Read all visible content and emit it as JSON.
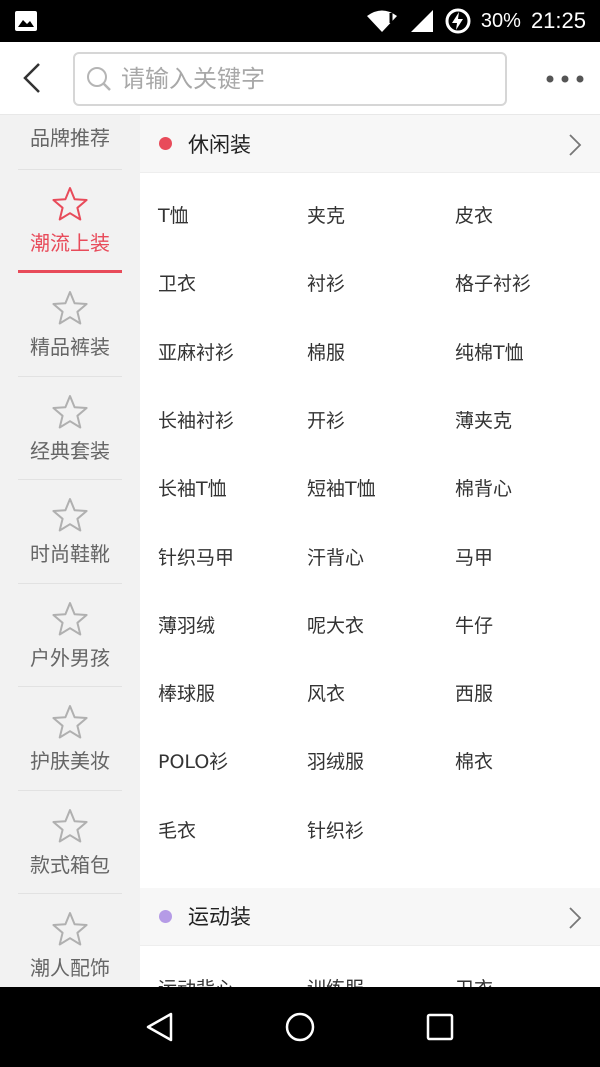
{
  "status_bar": {
    "battery": "30%",
    "time": "21:25"
  },
  "search": {
    "placeholder": "请输入关键字"
  },
  "sidebar": {
    "items": [
      {
        "label": "品牌推荐"
      },
      {
        "label": "潮流上装"
      },
      {
        "label": "精品裤装"
      },
      {
        "label": "经典套装"
      },
      {
        "label": "时尚鞋靴"
      },
      {
        "label": "户外男孩"
      },
      {
        "label": "护肤美妆"
      },
      {
        "label": "款式箱包"
      },
      {
        "label": "潮人配饰"
      }
    ],
    "active_index": 1
  },
  "sections": [
    {
      "title": "休闲装",
      "dot_color": "#e84b5a",
      "items": [
        "T恤",
        "夹克",
        "皮衣",
        "卫衣",
        "衬衫",
        "格子衬衫",
        "亚麻衬衫",
        "棉服",
        "纯棉T恤",
        "长袖衬衫",
        "开衫",
        "薄夹克",
        "长袖T恤",
        "短袖T恤",
        "棉背心",
        "针织马甲",
        "汗背心",
        "马甲",
        "薄羽绒",
        "呢大衣",
        "牛仔",
        "棒球服",
        "风衣",
        "西服",
        "POLO衫",
        "羽绒服",
        "棉衣",
        "毛衣",
        "针织衫"
      ]
    },
    {
      "title": "运动装",
      "dot_color": "#b59be6",
      "items": [
        "运动背心",
        "训练服",
        "卫衣"
      ]
    }
  ],
  "colors": {
    "accent": "#e84b5a"
  }
}
